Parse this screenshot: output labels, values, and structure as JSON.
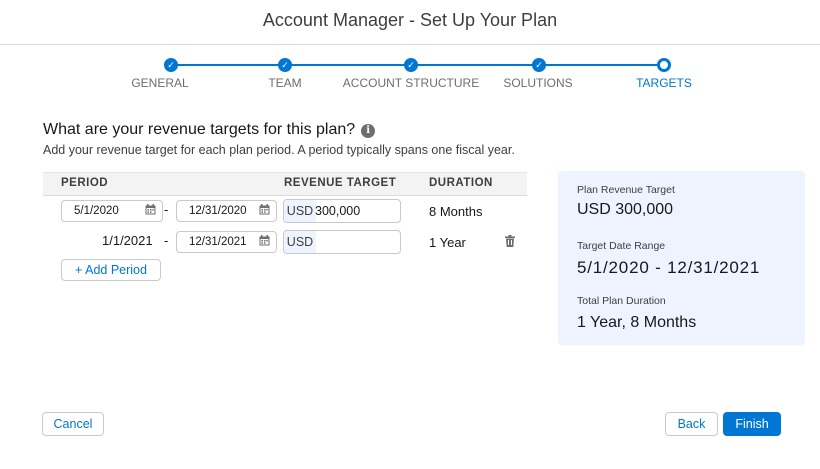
{
  "header": {
    "title": "Account Manager - Set Up Your Plan"
  },
  "progress": {
    "steps": [
      {
        "label": "GENERAL",
        "state": "complete"
      },
      {
        "label": "TEAM",
        "state": "complete"
      },
      {
        "label": "ACCOUNT STRUCTURE",
        "state": "complete"
      },
      {
        "label": "SOLUTIONS",
        "state": "complete"
      },
      {
        "label": "TARGETS",
        "state": "current"
      }
    ],
    "check_glyph": "✓"
  },
  "main": {
    "question": "What are your revenue targets for this plan?",
    "info_glyph": "i",
    "subtitle": "Add your revenue target for each plan period. A period typically spans one fiscal year."
  },
  "table": {
    "headers": {
      "period": "PERIOD",
      "revenue": "REVENUE TARGET",
      "duration": "DURATION"
    },
    "rows": [
      {
        "start": "5/1/2020",
        "end": "12/31/2020",
        "currency": "USD",
        "amount": "300,000",
        "duration": "8 Months"
      },
      {
        "start": "1/1/2021",
        "end": "12/31/2021",
        "currency": "USD",
        "amount": "",
        "duration": "1 Year"
      }
    ],
    "separator": "-"
  },
  "add_period": {
    "label": "+ Add Period"
  },
  "summary": {
    "revenue_label": "Plan Revenue Target",
    "revenue_value": "USD 300,000",
    "range_label": "Target Date Range",
    "range_value": "5/1/2020 - 12/31/2021",
    "duration_label": "Total Plan Duration",
    "duration_value": "1 Year, 8 Months"
  },
  "footer": {
    "cancel": "Cancel",
    "back": "Back",
    "finish": "Finish"
  },
  "colors": {
    "brand": "#0176d3",
    "summary_bg": "#eef4ff"
  },
  "icons": {
    "calendar": "calendar-icon",
    "trash": "trash-icon",
    "info": "info-icon",
    "check": "check-icon"
  }
}
